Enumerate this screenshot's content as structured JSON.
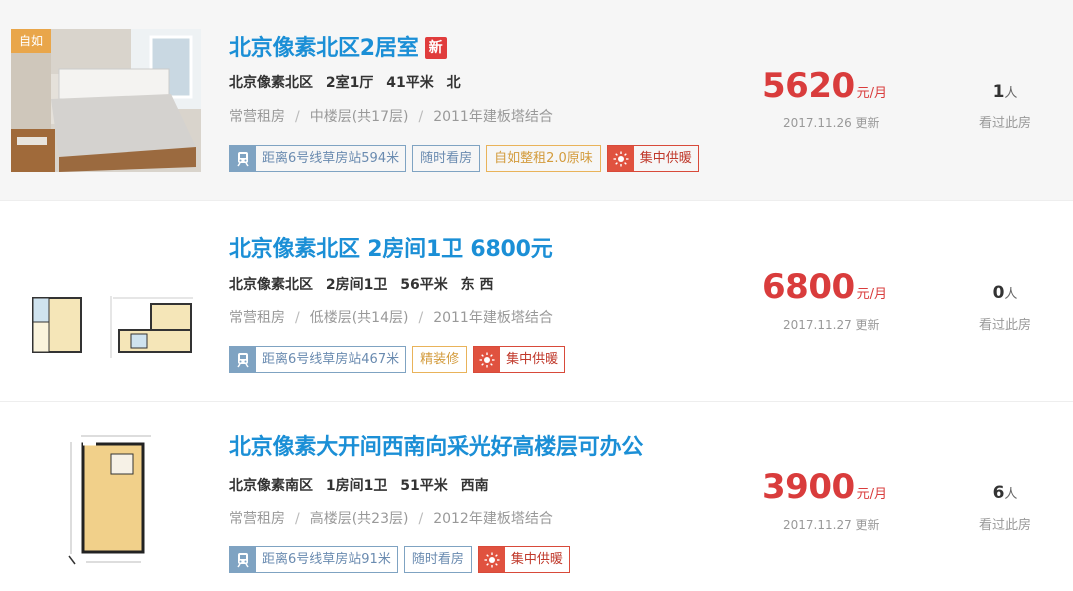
{
  "listings": [
    {
      "badge": "自如",
      "title": "北京像素北区2居室",
      "new_tag": "新",
      "community": "北京像素北区",
      "layout": "2室1厅",
      "area": "41平米",
      "orientation": "北",
      "rent_type": "常营租房",
      "floor": "中楼层(共17层)",
      "building": "2011年建板塔结合",
      "tags": {
        "subway": "距离6号线草房站594米",
        "t1": "随时看房",
        "t2": "自如整租2.0原味",
        "heating": "集中供暖"
      },
      "price": "5620",
      "price_unit": "元/月",
      "updated": "2017.11.26 更新",
      "viewers": "1",
      "viewers_unit": "人",
      "viewers_label": "看过此房"
    },
    {
      "title": "北京像素北区 2房间1卫 6800元",
      "community": "北京像素北区",
      "layout": "2房间1卫",
      "area": "56平米",
      "orientation": "东 西",
      "rent_type": "常营租房",
      "floor": "低楼层(共14层)",
      "building": "2011年建板塔结合",
      "tags": {
        "subway": "距离6号线草房站467米",
        "t1": "精装修",
        "heating": "集中供暖"
      },
      "price": "6800",
      "price_unit": "元/月",
      "updated": "2017.11.27 更新",
      "viewers": "0",
      "viewers_unit": "人",
      "viewers_label": "看过此房"
    },
    {
      "title": "北京像素大开间西南向采光好高楼层可办公",
      "community": "北京像素南区",
      "layout": "1房间1卫",
      "area": "51平米",
      "orientation": "西南",
      "rent_type": "常营租房",
      "floor": "高楼层(共23层)",
      "building": "2012年建板塔结合",
      "tags": {
        "subway": "距离6号线草房站91米",
        "t1": "随时看房",
        "heating": "集中供暖"
      },
      "price": "3900",
      "price_unit": "元/月",
      "updated": "2017.11.27 更新",
      "viewers": "6",
      "viewers_unit": "人",
      "viewers_label": "看过此房"
    }
  ],
  "colors": {
    "title": "#1b8fd6",
    "price": "#d93c3c",
    "subway_tag": "#7fa3c2",
    "heating_tag": "#e0523f",
    "ziru_badge": "#e9a64a"
  }
}
